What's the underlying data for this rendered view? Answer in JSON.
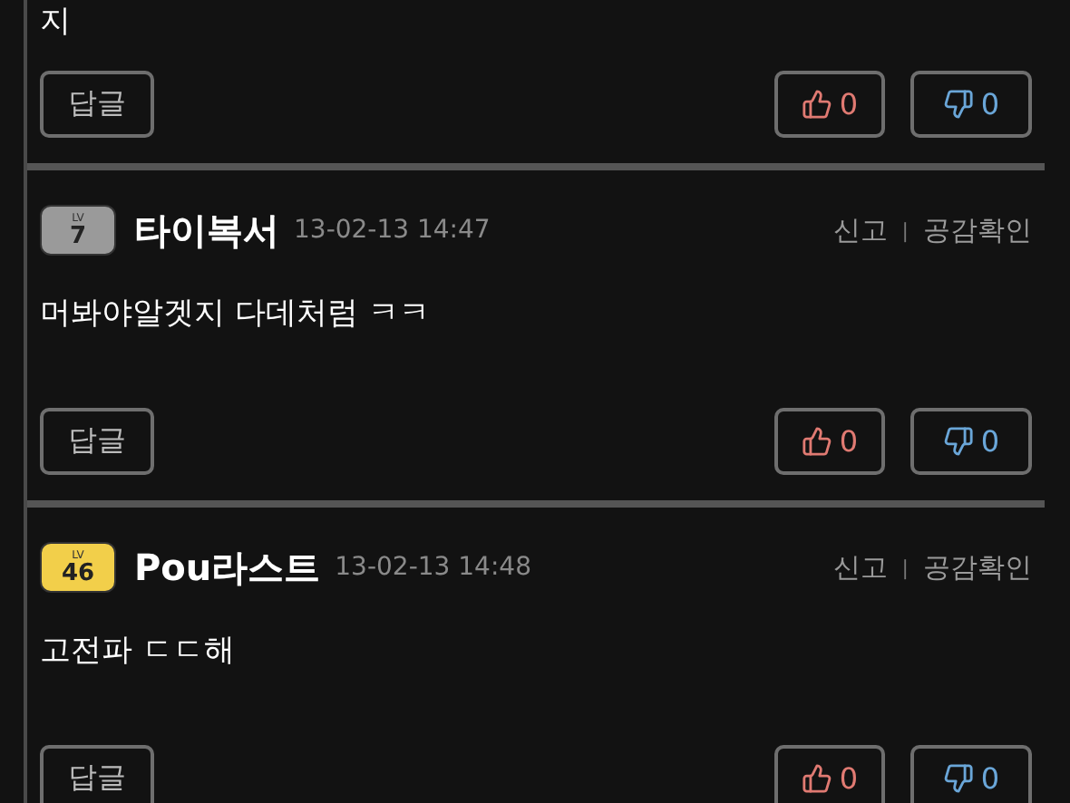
{
  "comments": [
    {
      "body": "지",
      "reply": "답글",
      "likes": "0",
      "dislikes": "0"
    },
    {
      "author": {
        "name": "타이복서",
        "lv": "LV",
        "level": "7",
        "color": "#9a9a9a"
      },
      "date": "13-02-13 14:47",
      "report": "신고",
      "sep": "|",
      "empathy": "공감확인",
      "body": "머봐야알겟지 다데처럼 ㅋㅋ",
      "reply": "답글",
      "likes": "0",
      "dislikes": "0"
    },
    {
      "author": {
        "name": "Pou라스트",
        "lv": "LV",
        "level": "46",
        "color": "#f2cf4a"
      },
      "date": "13-02-13 14:48",
      "report": "신고",
      "sep": "|",
      "empathy": "공감확인",
      "body": "고전파 ㄷㄷ해",
      "reply": "답글",
      "likes": "0",
      "dislikes": "0"
    }
  ]
}
